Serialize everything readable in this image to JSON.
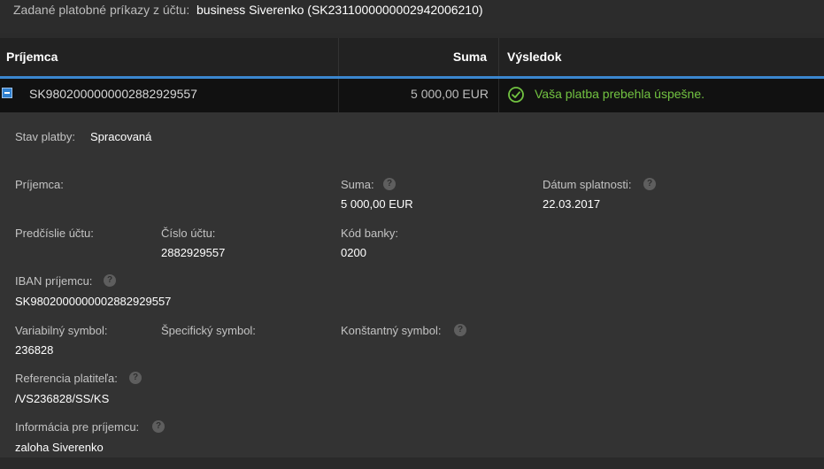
{
  "header": {
    "label": "Zadané platobné príkazy z účtu:",
    "account": "business Siverenko (SK2311000000002942006210)"
  },
  "table": {
    "columns": [
      "Príjemca",
      "Suma",
      "Výsledok"
    ],
    "row": {
      "recipient": "SK9802000000002882929557",
      "amount": "5 000,00 EUR",
      "result": "Vaša platba prebehla úspešne.",
      "result_icon": "check-circle-icon",
      "result_color": "#72c341"
    }
  },
  "details": {
    "status_label": "Stav platby:",
    "status_value": "Spracovaná",
    "recipient_label": "Príjemca:",
    "amount_label": "Suma:",
    "amount_value": "5 000,00  EUR",
    "due_label": "Dátum splatnosti:",
    "due_value": "22.03.2017",
    "prefix_label": "Predčíslie účtu:",
    "account_label": "Číslo účtu:",
    "account_value": "2882929557",
    "bank_label": "Kód banky:",
    "bank_value": "0200",
    "iban_label": "IBAN príjemcu:",
    "iban_value": "SK9802000000002882929557",
    "vs_label": "Variabilný symbol:",
    "vs_value": "236828",
    "ss_label": "Špecifický symbol:",
    "ks_label": "Konštantný symbol:",
    "ref_label": "Referencia platiteľa:",
    "ref_value": "/VS236828/SS/KS",
    "info_label": "Informácia pre príjemcu:",
    "info_value": "zaloha Siverenko"
  },
  "colors": {
    "accent": "#3b87cf",
    "success": "#72c341"
  },
  "help_icon": "?"
}
